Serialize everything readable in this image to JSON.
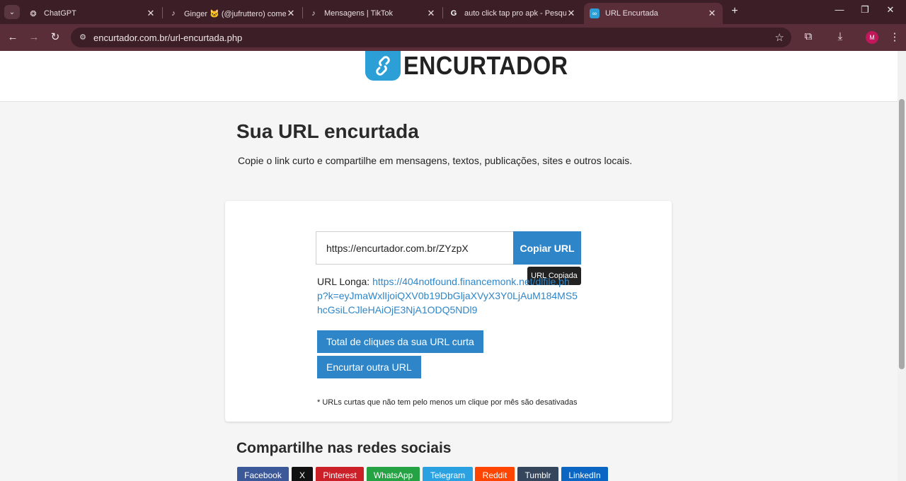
{
  "browser": {
    "tabs": [
      {
        "title": "ChatGPT",
        "icon": "chatgpt-icon"
      },
      {
        "title": "Ginger 🐱 (@jufruttero) começ",
        "icon": "tiktok-icon"
      },
      {
        "title": "Mensagens | TikTok",
        "icon": "tiktok-icon"
      },
      {
        "title": "auto click tap pro apk - Pesquis",
        "icon": "google-icon"
      },
      {
        "title": "URL Encurtada",
        "icon": "encurtador-icon"
      }
    ],
    "url": "encurtador.com.br/url-encurtada.php",
    "profile_initial": "M"
  },
  "header": {
    "logo_text": "ENCURTADOR"
  },
  "main": {
    "title": "Sua URL encurtada",
    "description": "Copie o link curto e compartilhe em mensagens, textos, publicações, sites e outros locais.",
    "short_url": "https://encurtador.com.br/ZYzpX",
    "copy_button": "Copiar URL",
    "tooltip": "URL Copiada",
    "long_url_label": "URL Longa:",
    "long_url": "https://404notfound.financemonk.net/dlfile.php?k=eyJmaWxlIjoiQXV0b19DbGljaXVyX3Y0LjAuM184MS5hcGsiLCJleHAiOjE3NjA1ODQ5NDl9",
    "clicks_button": "Total de cliques da sua URL curta",
    "shorten_another_button": "Encurtar outra URL",
    "note": "* URLs curtas que não tem pelo menos um clique por mês são desativadas"
  },
  "share": {
    "title": "Compartilhe nas redes sociais",
    "buttons": [
      {
        "label": "Facebook",
        "color": "#3b5998"
      },
      {
        "label": "X",
        "color": "#111111"
      },
      {
        "label": "Pinterest",
        "color": "#cb2027"
      },
      {
        "label": "WhatsApp",
        "color": "#25a244"
      },
      {
        "label": "Telegram",
        "color": "#2aa1e0"
      },
      {
        "label": "Reddit",
        "color": "#ff4500"
      },
      {
        "label": "Tumblr",
        "color": "#35465c"
      },
      {
        "label": "LinkedIn",
        "color": "#0a66c2"
      }
    ]
  },
  "colors": {
    "accent": "#2e86c9",
    "browser_frame": "#3c1e26"
  }
}
